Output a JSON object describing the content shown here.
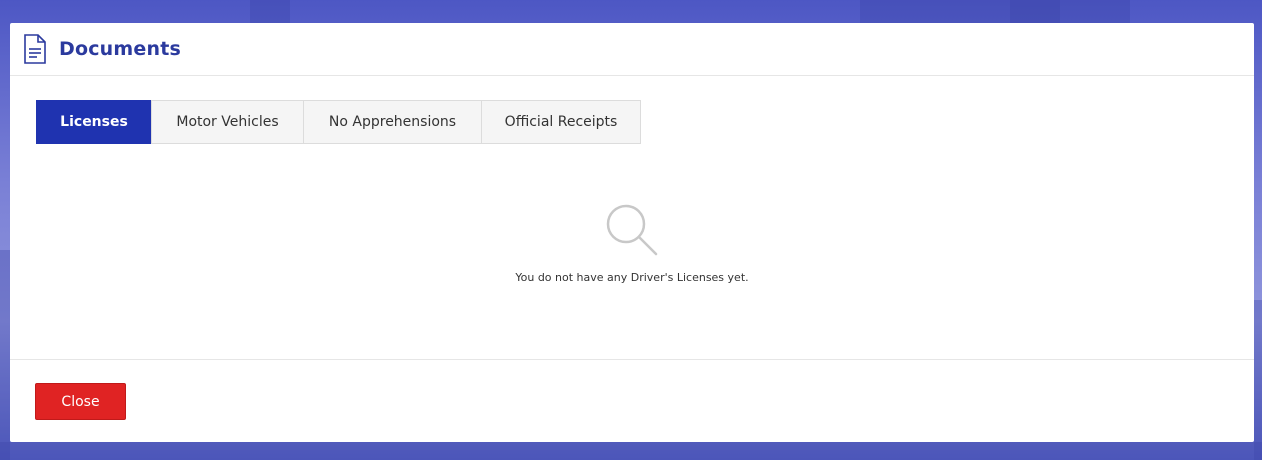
{
  "modal": {
    "title": "Documents",
    "icon": "document-icon"
  },
  "tabs": [
    {
      "label": "Licenses",
      "active": true
    },
    {
      "label": "Motor Vehicles",
      "active": false
    },
    {
      "label": "No Apprehensions",
      "active": false
    },
    {
      "label": "Official Receipts",
      "active": false
    }
  ],
  "empty_state": {
    "icon": "search-icon",
    "message": "You do not have any Driver's Licenses yet."
  },
  "footer": {
    "close_label": "Close"
  },
  "colors": {
    "primary": "#1f33b0",
    "title": "#2b3a9e",
    "danger": "#e02323",
    "background": "#7a80d6"
  }
}
